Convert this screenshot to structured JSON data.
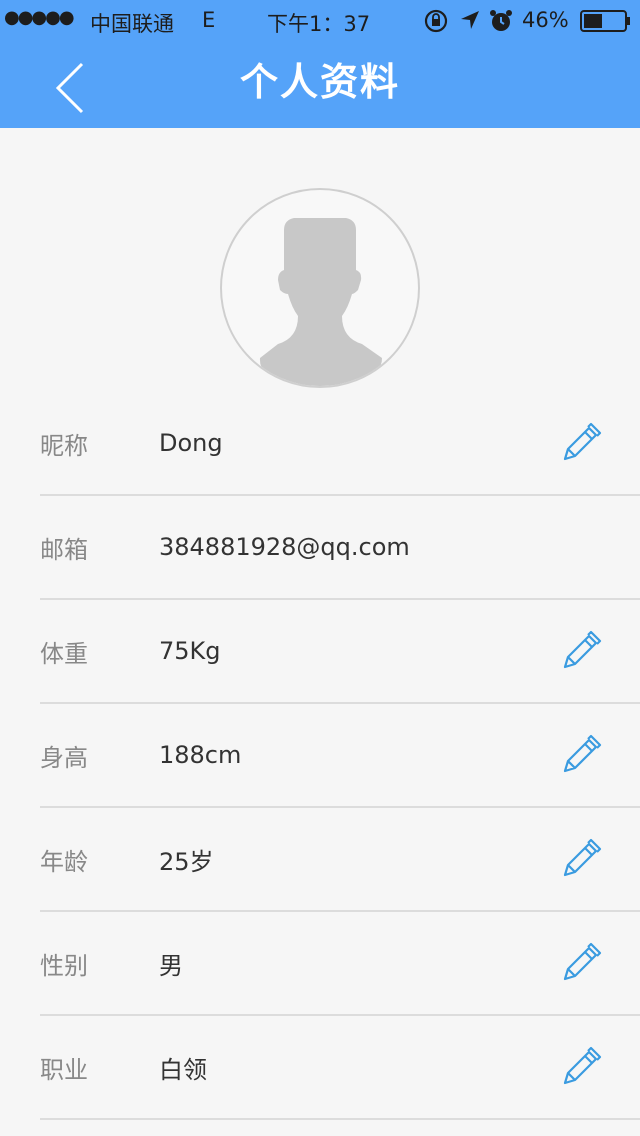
{
  "status_bar": {
    "signal": "●●●●●",
    "carrier": "中国联通",
    "network": "E",
    "time": "下午1：37",
    "battery": "46%",
    "battery_level": 0.46
  },
  "nav": {
    "title": "个人资料",
    "back_icon": "chevron-left-icon"
  },
  "profile": {
    "avatar_icon": "user-silhouette-icon",
    "fields": [
      {
        "label": "昵称",
        "value": "Dong",
        "editable": true
      },
      {
        "label": "邮箱",
        "value": "384881928@qq.com",
        "editable": false
      },
      {
        "label": "体重",
        "value": "75Kg",
        "editable": true
      },
      {
        "label": "身高",
        "value": "188cm",
        "editable": true
      },
      {
        "label": "年龄",
        "value": "25岁",
        "editable": true
      },
      {
        "label": "性别",
        "value": "男",
        "editable": true
      },
      {
        "label": "职业",
        "value": "白领",
        "editable": true
      }
    ]
  },
  "colors": {
    "header": "#55a3f9",
    "background": "#f6f6f6",
    "edit_icon": "#3a9be0",
    "divider": "#dcdcdc"
  }
}
